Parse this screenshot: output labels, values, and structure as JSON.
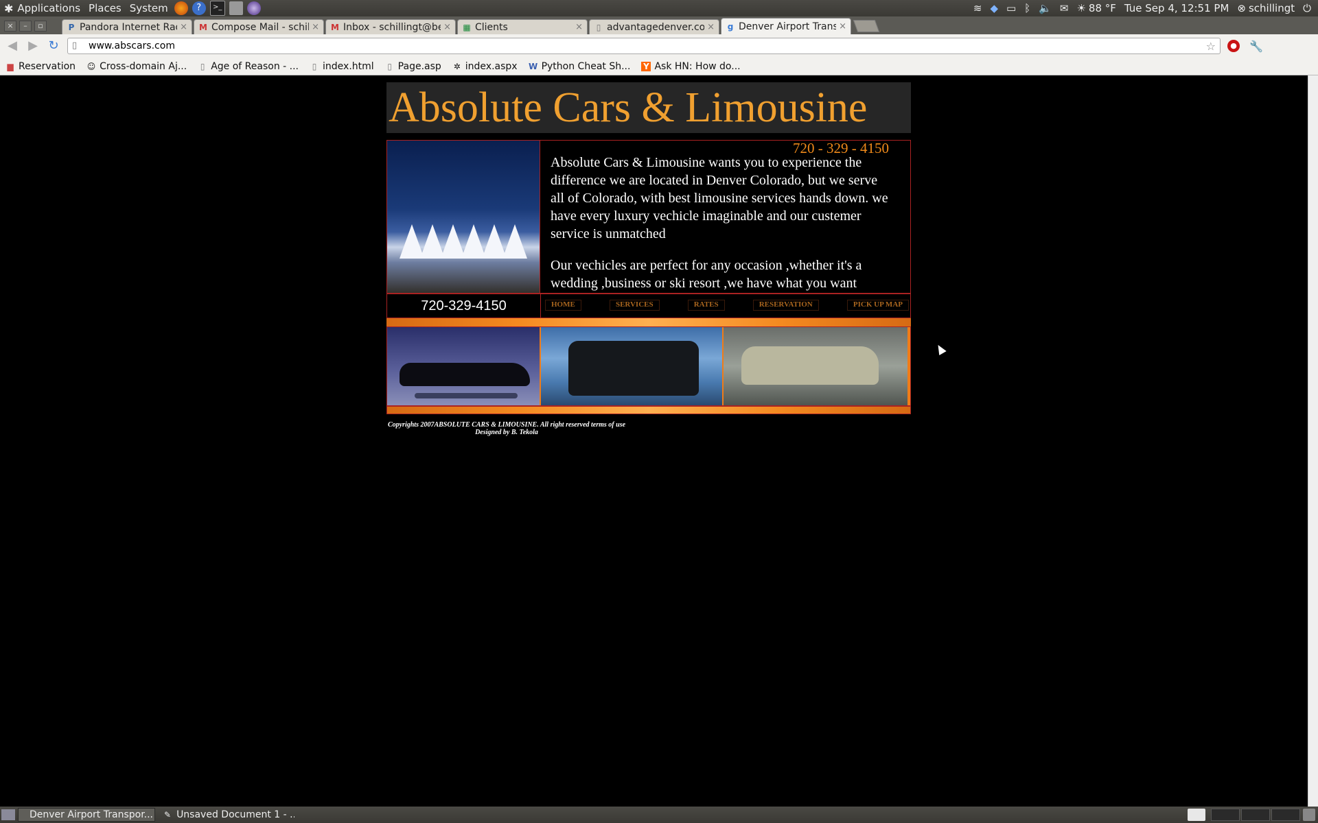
{
  "top_panel": {
    "menus": [
      "Applications",
      "Places",
      "System"
    ],
    "weather": "88 °F",
    "clock": "Tue Sep  4, 12:51 PM",
    "user": "schillingt"
  },
  "tabs": [
    {
      "label": "Pandora Internet Radio",
      "favicon": "P",
      "active": false
    },
    {
      "label": "Compose Mail - schilling",
      "favicon": "M",
      "active": false
    },
    {
      "label": "Inbox - schillingt@bette",
      "favicon": "M",
      "active": false
    },
    {
      "label": "Clients",
      "favicon": "▦",
      "active": false
    },
    {
      "label": "advantagedenver.com",
      "favicon": "▯",
      "active": false
    },
    {
      "label": "Denver Airport Transpor",
      "favicon": "g",
      "active": true
    }
  ],
  "toolbar": {
    "url": "www.abscars.com"
  },
  "bookmarks": [
    {
      "label": "Reservation",
      "icon": "folder-icon"
    },
    {
      "label": "Cross-domain Aj...",
      "icon": "person-icon"
    },
    {
      "label": "Age of Reason - ...",
      "icon": "page-icon"
    },
    {
      "label": "index.html",
      "icon": "page-icon"
    },
    {
      "label": "Page.asp",
      "icon": "page-icon"
    },
    {
      "label": "index.aspx",
      "icon": "bug-icon"
    },
    {
      "label": "Python Cheat Sh...",
      "icon": "wiki-icon"
    },
    {
      "label": "Ask HN: How do...",
      "icon": "ycombinator-icon"
    }
  ],
  "site": {
    "title": "Absolute Cars & Limousine",
    "phone_top": "720 - 329 - 4150",
    "intro_p1": "Absolute Cars & Limousine wants you to experience the difference we are located in Denver Colorado, but we serve",
    "intro_p1b": "all of Colorado, with best limousine services hands down. we have every luxury vechicle imaginable and our custemer service is unmatched",
    "intro_p2": "Our vechicles are perfect for any occasion ,whether it's a wedding ,business or ski resort ,we have what you want",
    "phone_nav": "720-329-4150",
    "nav": [
      "HOME",
      "SERVICES",
      "RATES",
      "RESERVATION",
      "PICK UP MAP"
    ],
    "footer_line1": "Copyrights 2007ABSOLUTE CARS & LIMOUSINE. All right reserved terms of use",
    "footer_line2": "Designed by B. Tekola"
  },
  "taskbar": [
    {
      "label": "Denver Airport Transpor...",
      "active": true
    },
    {
      "label": "Unsaved Document 1 - ...",
      "active": false
    }
  ],
  "colors": {
    "banner_text": "#f0a030",
    "phone_orange": "#f08a1a",
    "frame_red": "#aa2222"
  }
}
